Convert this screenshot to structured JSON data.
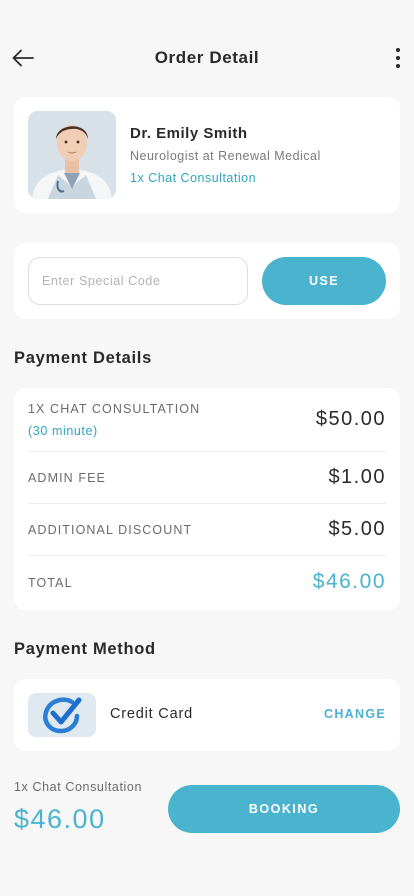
{
  "header": {
    "title": "Order Detail",
    "back_icon": "arrow-left-icon",
    "more_icon": "more-vertical-icon"
  },
  "doctor": {
    "name": "Dr. Emily Smith",
    "role": "Neurologist at Renewal Medical",
    "service": "1x Chat Consultation"
  },
  "promo": {
    "placeholder": "Enter Special Code",
    "value": "",
    "use_label": "USE"
  },
  "payment_details": {
    "title": "Payment Details",
    "rows": [
      {
        "label": "1X CHAT CONSULTATION",
        "sub": "(30 minute)",
        "amount": "$50.00"
      },
      {
        "label": "ADMIN FEE",
        "amount": "$1.00"
      },
      {
        "label": "ADDITIONAL DISCOUNT",
        "amount": "$5.00"
      },
      {
        "label": "TOTAL",
        "amount": "$46.00"
      }
    ]
  },
  "payment_method": {
    "title": "Payment Method",
    "method": "Credit Card",
    "change_label": "CHANGE",
    "icon": "credit-card-check-logo-icon"
  },
  "footer": {
    "service": "1x Chat Consultation",
    "price": "$46.00",
    "booking_label": "BOOKING"
  },
  "colors": {
    "accent": "#4ab3cd",
    "accent_text": "#2ea5c4",
    "background": "#f7f7f7",
    "card": "#ffffff"
  }
}
